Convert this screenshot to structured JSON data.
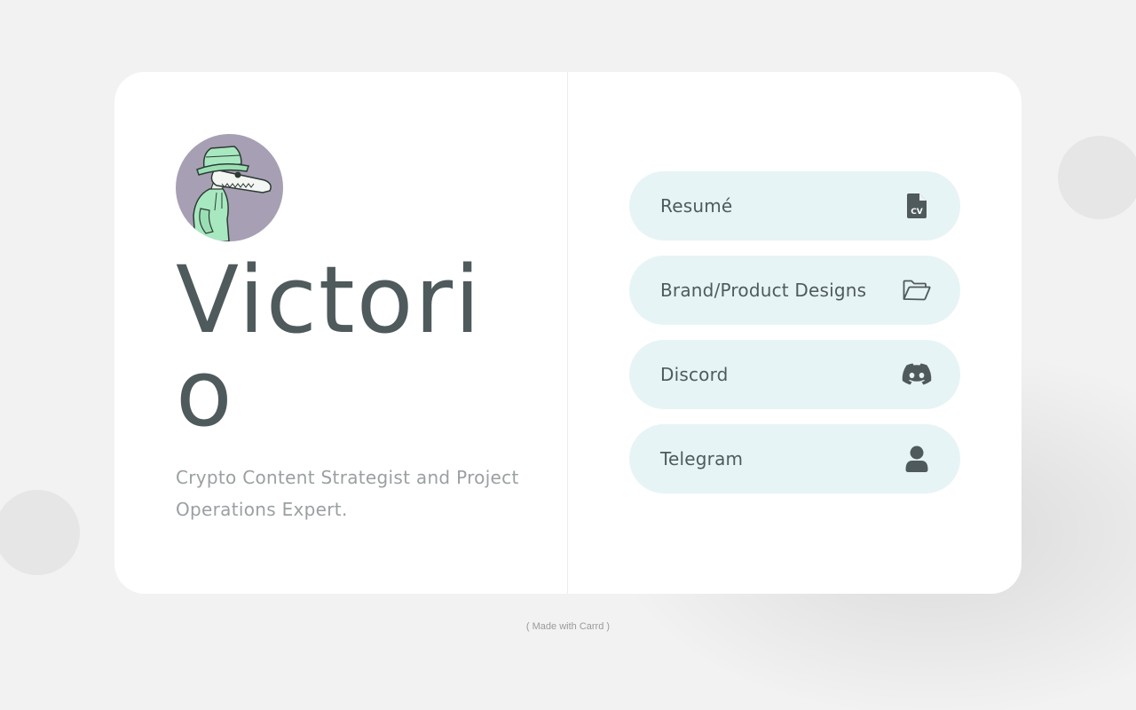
{
  "profile": {
    "name": "Victorio",
    "tagline": "Crypto Content Strategist and Project Operations Expert."
  },
  "links": [
    {
      "label": "Resumé",
      "icon": "cv-file-icon"
    },
    {
      "label": "Brand/Product Designs",
      "icon": "folder-open-icon"
    },
    {
      "label": "Discord",
      "icon": "discord-icon"
    },
    {
      "label": "Telegram",
      "icon": "user-icon"
    }
  ],
  "footer": {
    "credit": "( Made with Carrd )"
  },
  "colors": {
    "background": "#f2f2f2",
    "card": "#ffffff",
    "button": "#e7f4f5",
    "text_dark": "#4f5a5c",
    "text_muted": "#9aa0a2",
    "avatar_bg": "#a79fb4"
  }
}
